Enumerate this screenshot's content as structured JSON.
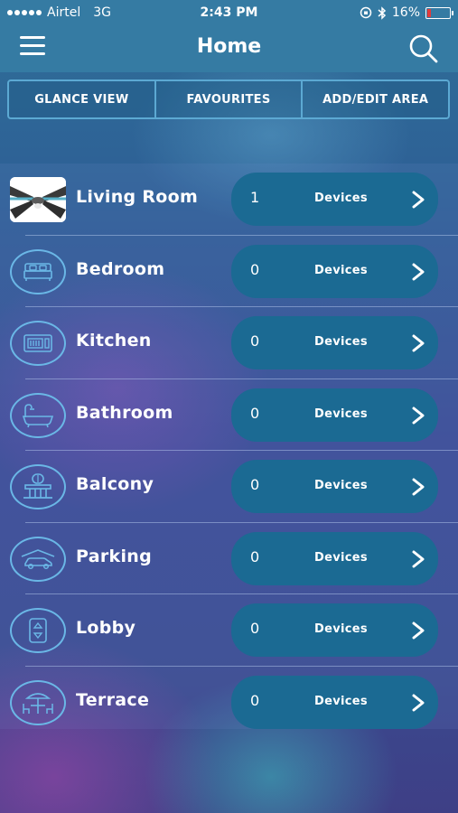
{
  "status_bar": {
    "carrier": "Airtel",
    "network": "3G",
    "time": "2:43 PM",
    "battery_percent": "16%",
    "battery_level": 0.16
  },
  "nav": {
    "title": "Home"
  },
  "tabs": [
    {
      "label": "GLANCE VIEW"
    },
    {
      "label": "FAVOURITES"
    },
    {
      "label": "ADD/EDIT AREA"
    }
  ],
  "rooms": [
    {
      "name": "Living Room",
      "count": "1",
      "devices_label": "Devices",
      "icon": "ceiling-fan-photo"
    },
    {
      "name": "Bedroom",
      "count": "0",
      "devices_label": "Devices",
      "icon": "bed-icon"
    },
    {
      "name": "Kitchen",
      "count": "0",
      "devices_label": "Devices",
      "icon": "microwave-icon"
    },
    {
      "name": "Bathroom",
      "count": "0",
      "devices_label": "Devices",
      "icon": "bathtub-icon"
    },
    {
      "name": "Balcony",
      "count": "0",
      "devices_label": "Devices",
      "icon": "balcony-icon"
    },
    {
      "name": "Parking",
      "count": "0",
      "devices_label": "Devices",
      "icon": "car-icon"
    },
    {
      "name": "Lobby",
      "count": "0",
      "devices_label": "Devices",
      "icon": "elevator-icon"
    },
    {
      "name": "Terrace",
      "count": "0",
      "devices_label": "Devices",
      "icon": "umbrella-table-icon"
    }
  ],
  "colors": {
    "accent": "#6ab7e6",
    "pill": "#1b6a93",
    "battery_low": "#e23b3b"
  }
}
